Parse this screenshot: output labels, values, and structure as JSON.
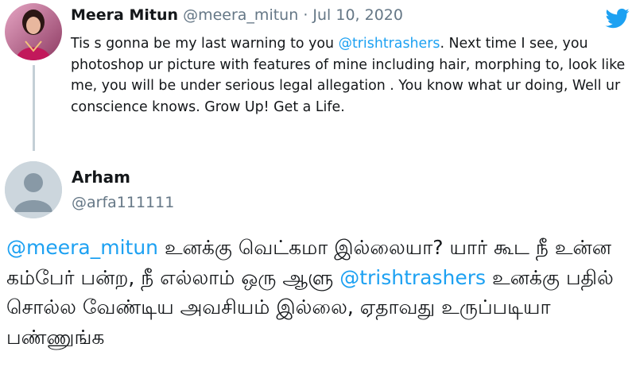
{
  "tweet1": {
    "author_name": "Meera Mitun",
    "author_handle": "@meera_mitun",
    "separator": "·",
    "date": "Jul 10, 2020",
    "text_before_mention": "Tis s gonna be my last warning to you ",
    "mention": "@trishtrashers",
    "text_after_mention": ". Next time I see, you photoshop ur picture with features of mine including hair, morphing to, look like me, you will be under serious legal allegation . You know what ur doing, Well ur conscience knows. Grow Up! Get a Life."
  },
  "tweet2": {
    "author_name": "Arham",
    "author_handle": "@arfa111111",
    "mention1": "@meera_mitun",
    "text_part1": " உனக்கு வெட்கமா இல்லையா? யார் கூட நீ உன்ன கம்பேர் பன்ற, நீ எல்லாம் ஒரு ஆளு ",
    "mention2": "@trishtrashers",
    "text_part2": " உனக்கு பதில் சொல்ல வேண்டிய அவசியம் இல்லை, ஏதாவது உருப்படியா பண்ணுங்க"
  },
  "icons": {
    "twitter": "twitter-bird-icon",
    "default_avatar": "default-avatar-icon"
  },
  "colors": {
    "link": "#1da1f2",
    "secondary_text": "#657786",
    "thread_line": "#c4cfd6"
  }
}
